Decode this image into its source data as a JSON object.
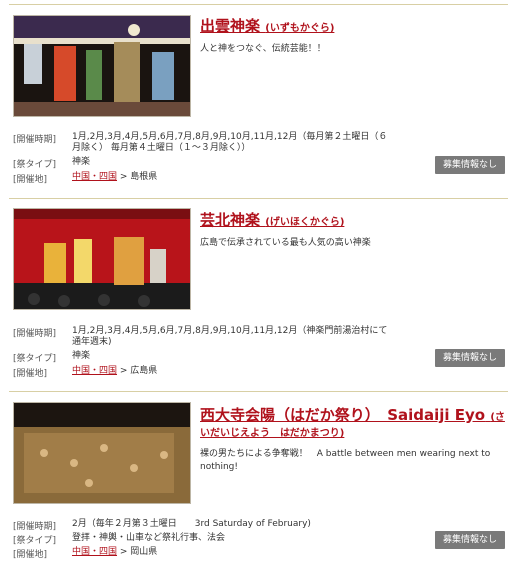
{
  "labels": {
    "period": "[開催時期]",
    "type": "[祭タイプ]",
    "place": "[開催地]",
    "button": "募集情報なし",
    "sep": " > "
  },
  "entries": [
    {
      "title": "出雲神楽",
      "reading": "(いずもかぐら)",
      "description": "人と神をつなぐ、伝統芸能！！",
      "period_line1": "1月,2月,3月,4月,5月,6月,7月,8月,9月,10月,11月,12月（毎月第２土曜日（６",
      "period_line2": "月除く） 毎月第４土曜日（１～３月除く））",
      "type": "神楽",
      "region": "中国・四国",
      "prefecture": "島根県"
    },
    {
      "title": "芸北神楽",
      "reading": "(げいほくかぐら)",
      "description": "広島で伝承されている最も人気の高い神楽",
      "period_line1": "1月,2月,3月,4月,5月,6月,7月,8月,9月,10月,11月,12月（神楽門前湯治村にて",
      "period_line2": "通年週末)",
      "type": "神楽",
      "region": "中国・四国",
      "prefecture": "広島県"
    },
    {
      "title": "西大寺会陽（はだか祭り）　Saidaiji Eyo",
      "reading": "(さ",
      "reading_line2": "いだいじえよう　はだかまつり)",
      "description_line1": "裸の男たちによる争奪戦！　A battle between men wearing next to",
      "description_line2": "nothing!",
      "period_line1": "2月（毎年２月第３土曜日　　3rd Saturday of February)",
      "type": "登拝・神輿・山車など祭礼行事、法会",
      "region": "中国・四国",
      "prefecture": "岡山県"
    }
  ]
}
